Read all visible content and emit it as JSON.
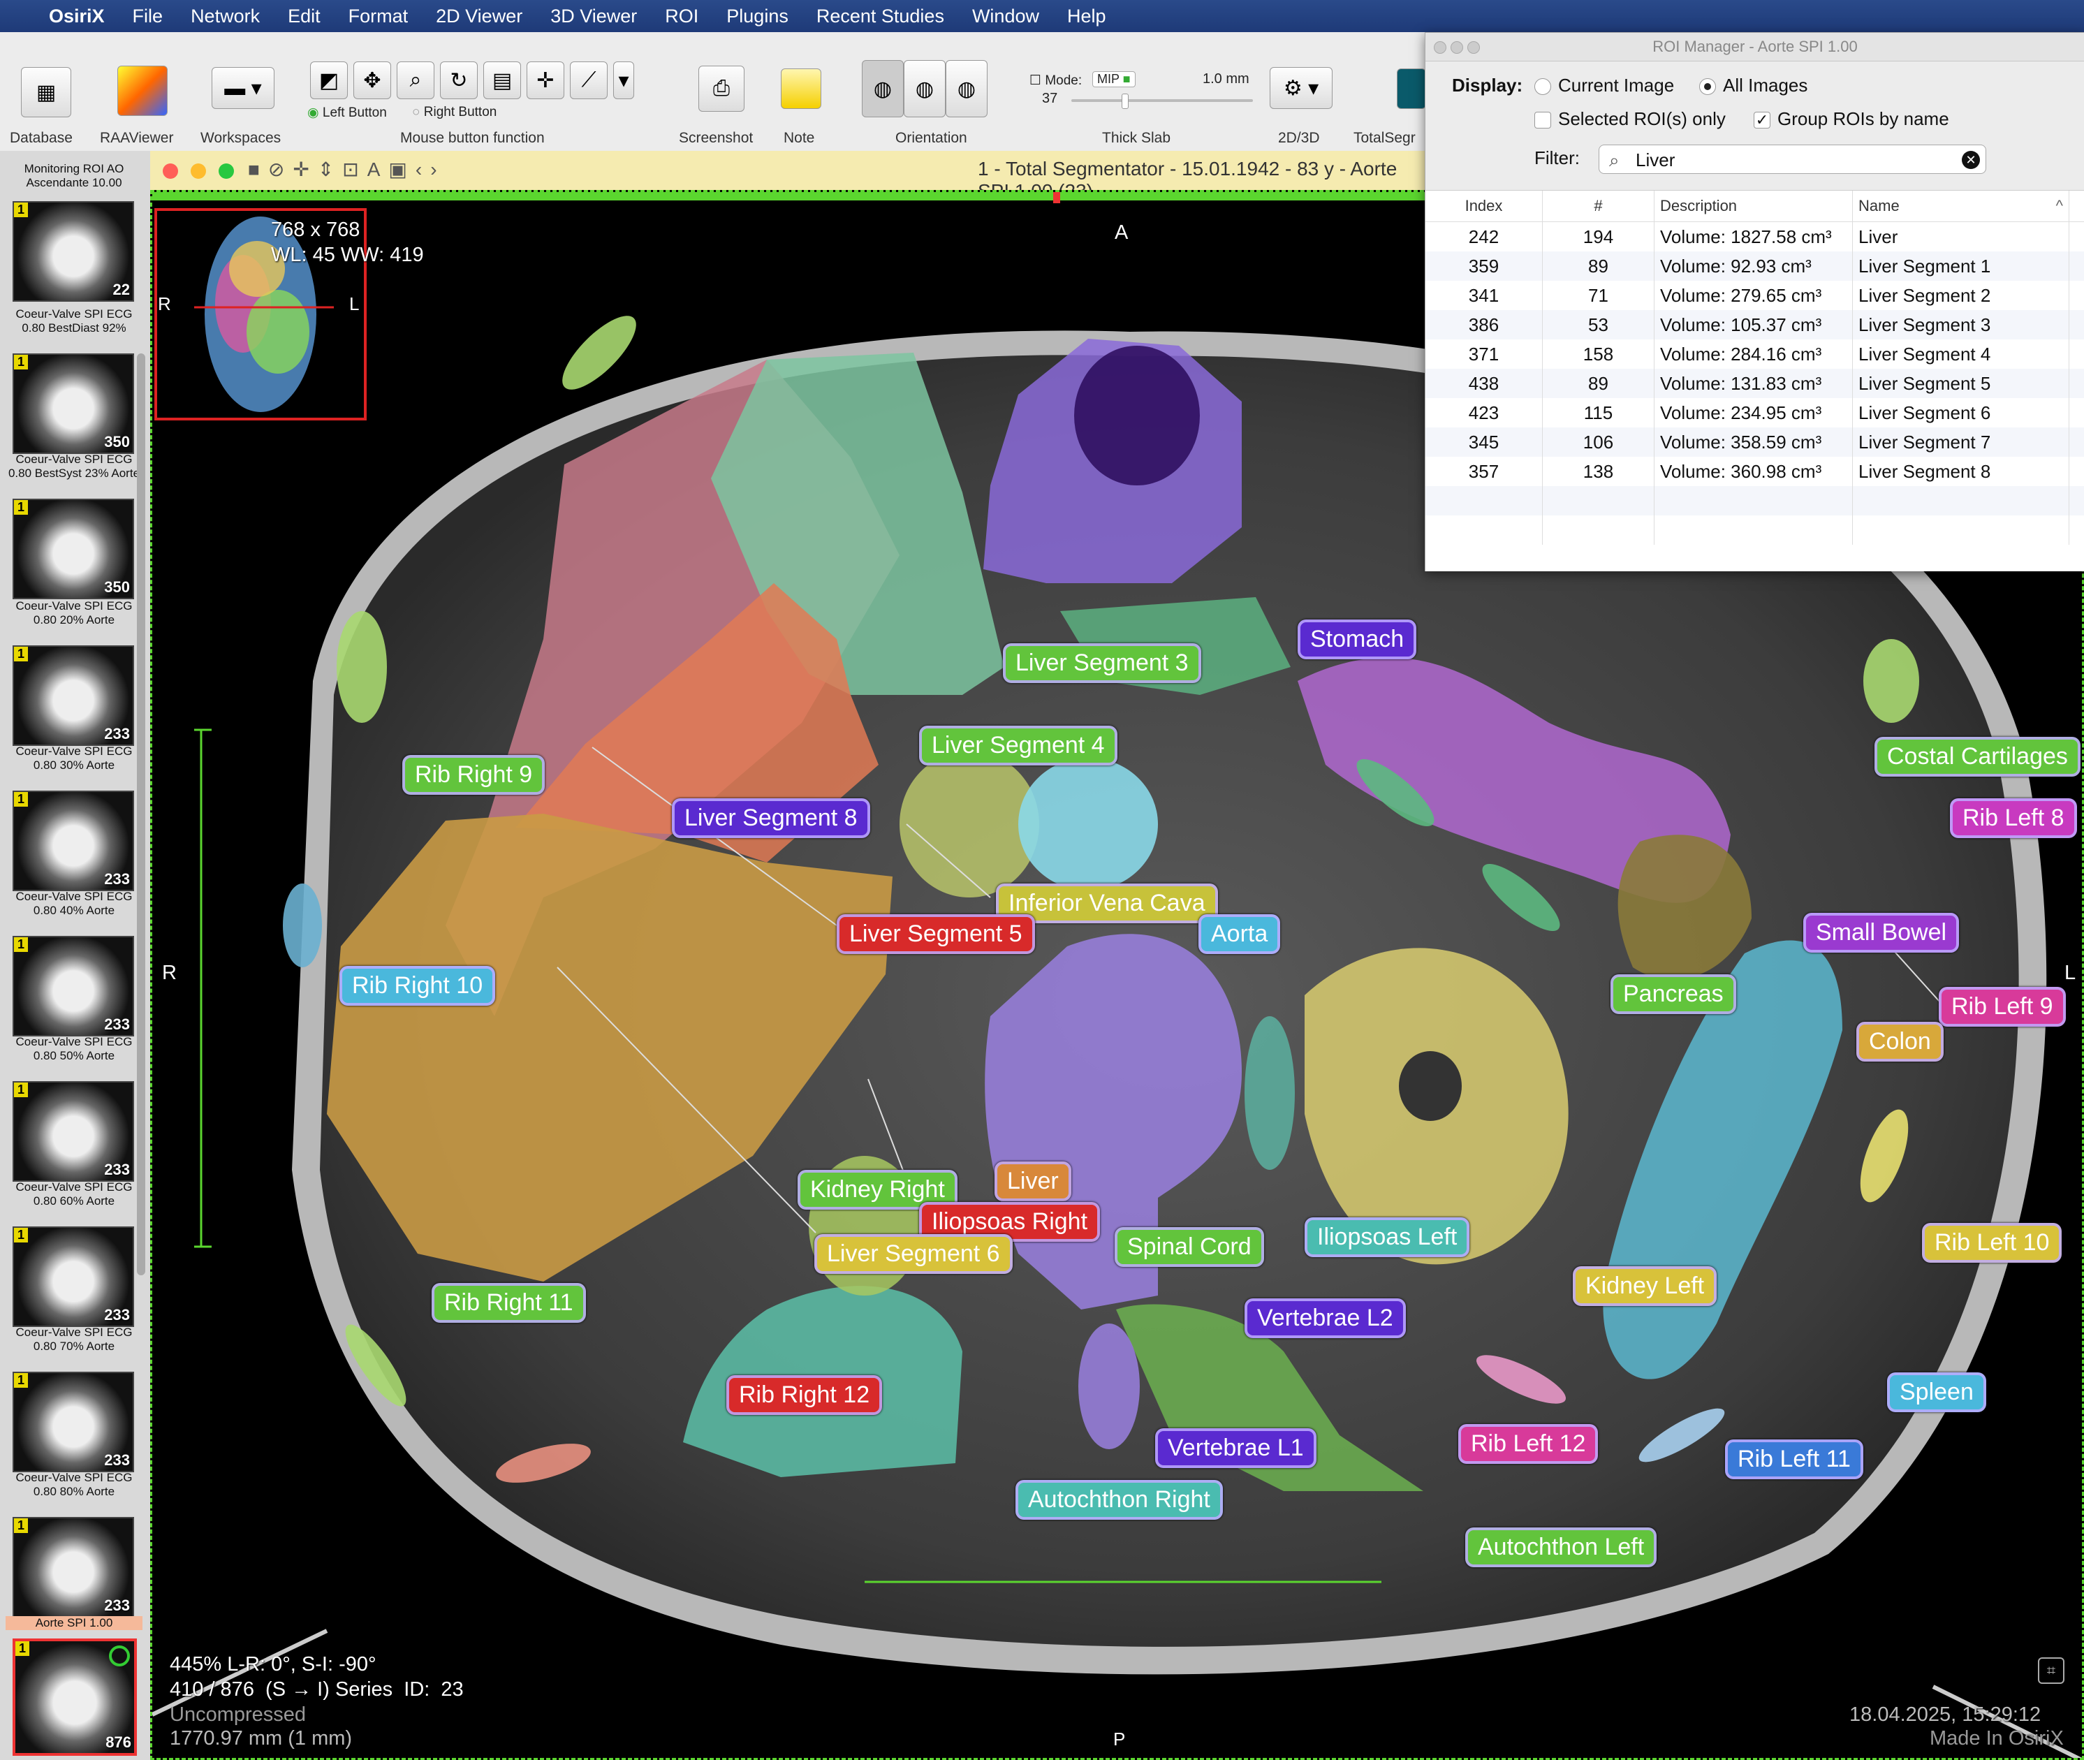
{
  "menubar": {
    "app_name": "OsiriX",
    "items": [
      "File",
      "Network",
      "Edit",
      "Format",
      "2D Viewer",
      "3D Viewer",
      "ROI",
      "Plugins",
      "Recent Studies",
      "Window",
      "Help"
    ]
  },
  "toolbar": {
    "database": "Database",
    "raaviewer": "RAAViewer",
    "workspaces": "Workspaces",
    "left_button": "Left Button",
    "right_button": "Right Button",
    "mouse_function": "Mouse button function",
    "screenshot": "Screenshot",
    "note": "Note",
    "orientation": "Orientation",
    "mode_label": "Mode:",
    "mode_value": "MIP",
    "slab_count": "37",
    "slab_mm": "1.0 mm",
    "thick_slab": "Thick Slab",
    "twod3d": "2D/3D",
    "totalseg": "TotalSegr"
  },
  "sidebar": {
    "top_caption": "Monitoring ROI AO Ascendante 10.00",
    "series": [
      {
        "count": "22",
        "caption": "Coeur-Valve SPI ECG 0.80 BestDiast 92%"
      },
      {
        "count": "350",
        "caption": "Coeur-Valve SPI ECG 0.80 BestSyst 23% Aorte"
      },
      {
        "count": "350",
        "caption": "Coeur-Valve SPI ECG 0.80 20% Aorte"
      },
      {
        "count": "233",
        "caption": "Coeur-Valve SPI ECG 0.80 30% Aorte"
      },
      {
        "count": "233",
        "caption": "Coeur-Valve SPI ECG 0.80 40% Aorte"
      },
      {
        "count": "233",
        "caption": "Coeur-Valve SPI ECG 0.80 50% Aorte"
      },
      {
        "count": "233",
        "caption": "Coeur-Valve SPI ECG 0.80 60% Aorte"
      },
      {
        "count": "233",
        "caption": "Coeur-Valve SPI ECG 0.80 70% Aorte"
      },
      {
        "count": "233",
        "caption": "Coeur-Valve SPI ECG 0.80 80% Aorte"
      },
      {
        "count": "233",
        "caption": "Aorte SPI 1.00"
      }
    ],
    "selected_count": "876",
    "badge": "1"
  },
  "viewer": {
    "title": "1 - Total Segmentator - 15.01.1942 - 83 y - Aorte SPI 1.00 (23)",
    "matrix": "768 x 768",
    "wlww": "WL: 45 WW: 419",
    "orient_top": "A",
    "orient_bottom": "P",
    "orient_left": "R",
    "orient_right": "L",
    "mini_left": "R",
    "mini_right": "L",
    "zoom_line": "445% L-R: 0°, S-I: -90°",
    "slice_line": "410 / 876  (S → I) Series  ID:  23",
    "compression": "Uncompressed",
    "position": "1770.97 mm (1 mm)",
    "datetime": "18.04.2025, 15:29:12",
    "made_in": "Made In OsiriX"
  },
  "roi_labels": [
    {
      "text": "Stomach",
      "color": "#5a2ad0"
    },
    {
      "text": "Liver Segment 3",
      "color": "#62c43c"
    },
    {
      "text": "Liver Segment 4",
      "color": "#62c43c"
    },
    {
      "text": "Rib Right 9",
      "color": "#62c43c"
    },
    {
      "text": "Liver Segment 8",
      "color": "#5a2ad0"
    },
    {
      "text": "Costal Cartilages",
      "color": "#62c43c"
    },
    {
      "text": "Rib Left 8",
      "color": "#c83ac0"
    },
    {
      "text": "Inferior Vena Cava",
      "color": "#c7c23a"
    },
    {
      "text": "Liver Segment 5",
      "color": "#d82a2a"
    },
    {
      "text": "Aorta",
      "color": "#4ab8dc"
    },
    {
      "text": "Rib Right 10",
      "color": "#4ab8dc"
    },
    {
      "text": "Small Bowel",
      "color": "#9a3ad0"
    },
    {
      "text": "Pancreas",
      "color": "#62c43c"
    },
    {
      "text": "Rib Left 9",
      "color": "#d83a9a"
    },
    {
      "text": "Colon",
      "color": "#d8a83a"
    },
    {
      "text": "Kidney Right",
      "color": "#62c43c"
    },
    {
      "text": "Liver",
      "color": "#d8883a"
    },
    {
      "text": "Iliopsoas Right",
      "color": "#d82a2a"
    },
    {
      "text": "Liver Segment 6",
      "color": "#d8c23a"
    },
    {
      "text": "Spinal Cord",
      "color": "#62c43c"
    },
    {
      "text": "Iliopsoas Left",
      "color": "#4abcb0"
    },
    {
      "text": "Rib Left 10",
      "color": "#d8c23a"
    },
    {
      "text": "Kidney Left",
      "color": "#d8c23a"
    },
    {
      "text": "Rib Right 11",
      "color": "#62c43c"
    },
    {
      "text": "Vertebrae L2",
      "color": "#5a2ad0"
    },
    {
      "text": "Rib Right 12",
      "color": "#d82a2a"
    },
    {
      "text": "Spleen",
      "color": "#4ab8dc"
    },
    {
      "text": "Vertebrae L1",
      "color": "#5a2ad0"
    },
    {
      "text": "Rib Left 12",
      "color": "#d83a9a"
    },
    {
      "text": "Rib Left 11",
      "color": "#3a7ad8"
    },
    {
      "text": "Autochthon Right",
      "color": "#4abcb0"
    },
    {
      "text": "Autochthon Left",
      "color": "#62c43c"
    }
  ],
  "roi_manager": {
    "title": "ROI Manager - Aorte SPI 1.00",
    "display_label": "Display:",
    "current_image": "Current Image",
    "all_images": "All Images",
    "selected_only": "Selected ROI(s) only",
    "group_by_name": "Group ROIs by name",
    "filter_label": "Filter:",
    "filter_value": "Liver",
    "columns": [
      "Index",
      "#",
      "Description",
      "Name"
    ],
    "rows": [
      {
        "index": "242",
        "count": "194",
        "desc": "Volume: 1827.58 cm³",
        "name": "Liver"
      },
      {
        "index": "359",
        "count": "89",
        "desc": "Volume: 92.93 cm³",
        "name": "Liver Segment 1"
      },
      {
        "index": "341",
        "count": "71",
        "desc": "Volume: 279.65 cm³",
        "name": "Liver Segment 2"
      },
      {
        "index": "386",
        "count": "53",
        "desc": "Volume: 105.37 cm³",
        "name": "Liver Segment 3"
      },
      {
        "index": "371",
        "count": "158",
        "desc": "Volume: 284.16 cm³",
        "name": "Liver Segment 4"
      },
      {
        "index": "438",
        "count": "89",
        "desc": "Volume: 131.83 cm³",
        "name": "Liver Segment 5"
      },
      {
        "index": "423",
        "count": "115",
        "desc": "Volume: 234.95 cm³",
        "name": "Liver Segment 6"
      },
      {
        "index": "345",
        "count": "106",
        "desc": "Volume: 358.59 cm³",
        "name": "Liver Segment 7"
      },
      {
        "index": "357",
        "count": "138",
        "desc": "Volume: 360.98 cm³",
        "name": "Liver Segment 8"
      }
    ]
  }
}
